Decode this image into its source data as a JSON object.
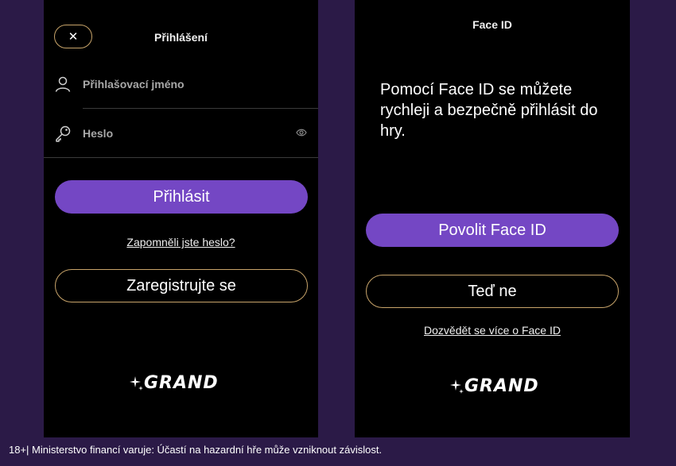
{
  "login": {
    "title": "Přihlášení",
    "close_label": "✕",
    "username_label": "Přihlašovací jméno",
    "password_label": "Heslo",
    "login_button": "Přihlásit",
    "forgot_password": "Zapomněli jste heslo?",
    "register_button": "Zaregistrujte se",
    "brand": "GRAND"
  },
  "faceid": {
    "title": "Face ID",
    "message": "Pomocí Face ID se můžete rychleji a bezpečně přihlásit do hry.",
    "enable_button": "Povolit Face ID",
    "not_now_button": "Teď ne",
    "learn_more": "Dozvědět se více o Face ID",
    "brand": "GRAND"
  },
  "footer": {
    "disclaimer": "18+| Ministerstvo financí varuje: Účastí na hazardní hře může vzniknout závislost."
  },
  "colors": {
    "background": "#2b1a47",
    "primary": "#7447c4",
    "accent_border": "#c8a46a"
  },
  "icons": {
    "close": "close-icon",
    "user": "user-icon",
    "key": "key-icon",
    "eye": "eye-icon",
    "sparkle": "sparkle-icon",
    "spade": "spade-icon"
  }
}
